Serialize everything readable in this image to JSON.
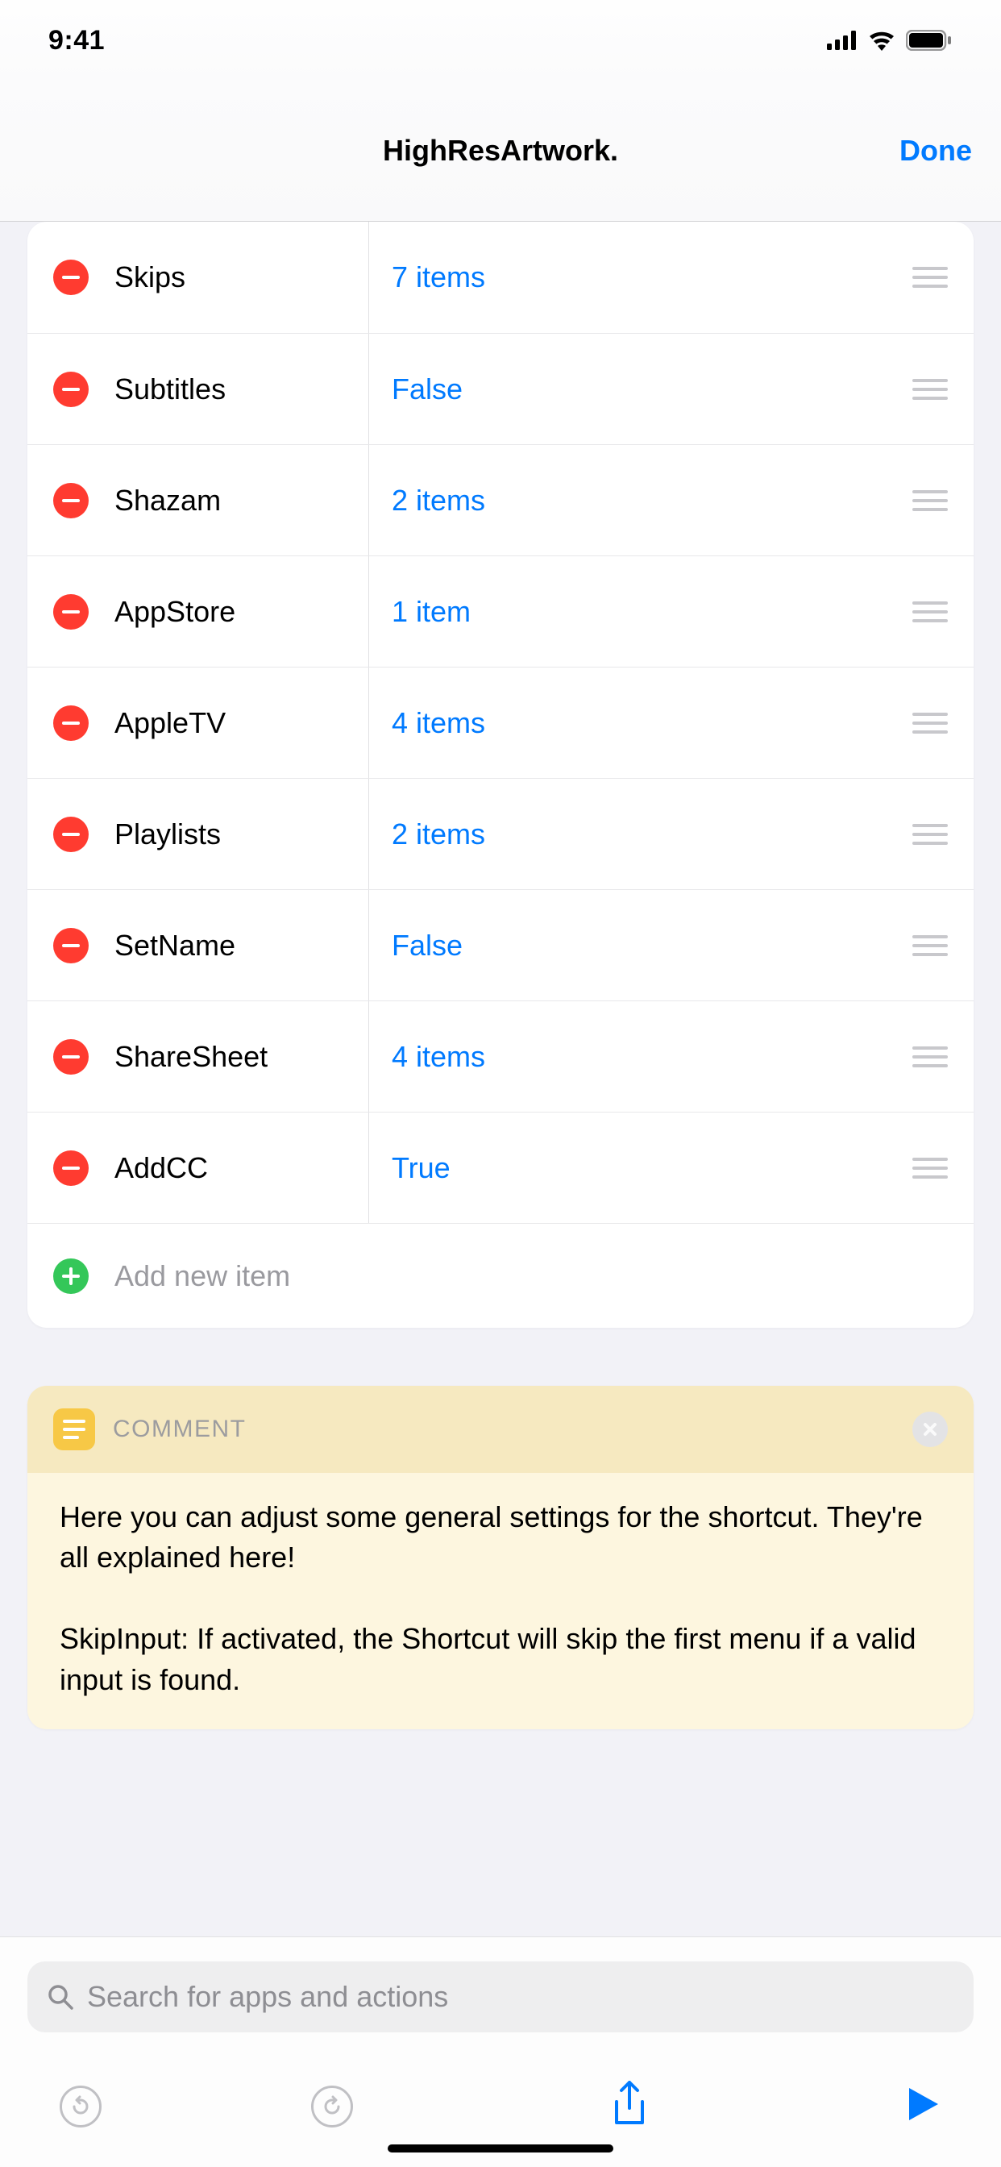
{
  "status": {
    "time": "9:41"
  },
  "nav": {
    "title": "HighResArtwork.",
    "done": "Done"
  },
  "dictionary": {
    "items": [
      {
        "key": "Skips",
        "value": "7 items"
      },
      {
        "key": "Subtitles",
        "value": "False"
      },
      {
        "key": "Shazam",
        "value": "2 items"
      },
      {
        "key": "AppStore",
        "value": "1 item"
      },
      {
        "key": "AppleTV",
        "value": "4 items"
      },
      {
        "key": "Playlists",
        "value": "2 items"
      },
      {
        "key": "SetName",
        "value": "False"
      },
      {
        "key": "ShareSheet",
        "value": "4 items"
      },
      {
        "key": "AddCC",
        "value": "True"
      }
    ],
    "addLabel": "Add new item"
  },
  "comment": {
    "title": "COMMENT",
    "body": "Here you can adjust some general settings for the shortcut. They're all explained here!\n\nSkipInput: If activated, the Shortcut will skip the first menu if a valid input is found."
  },
  "search": {
    "placeholder": "Search for apps and actions"
  }
}
